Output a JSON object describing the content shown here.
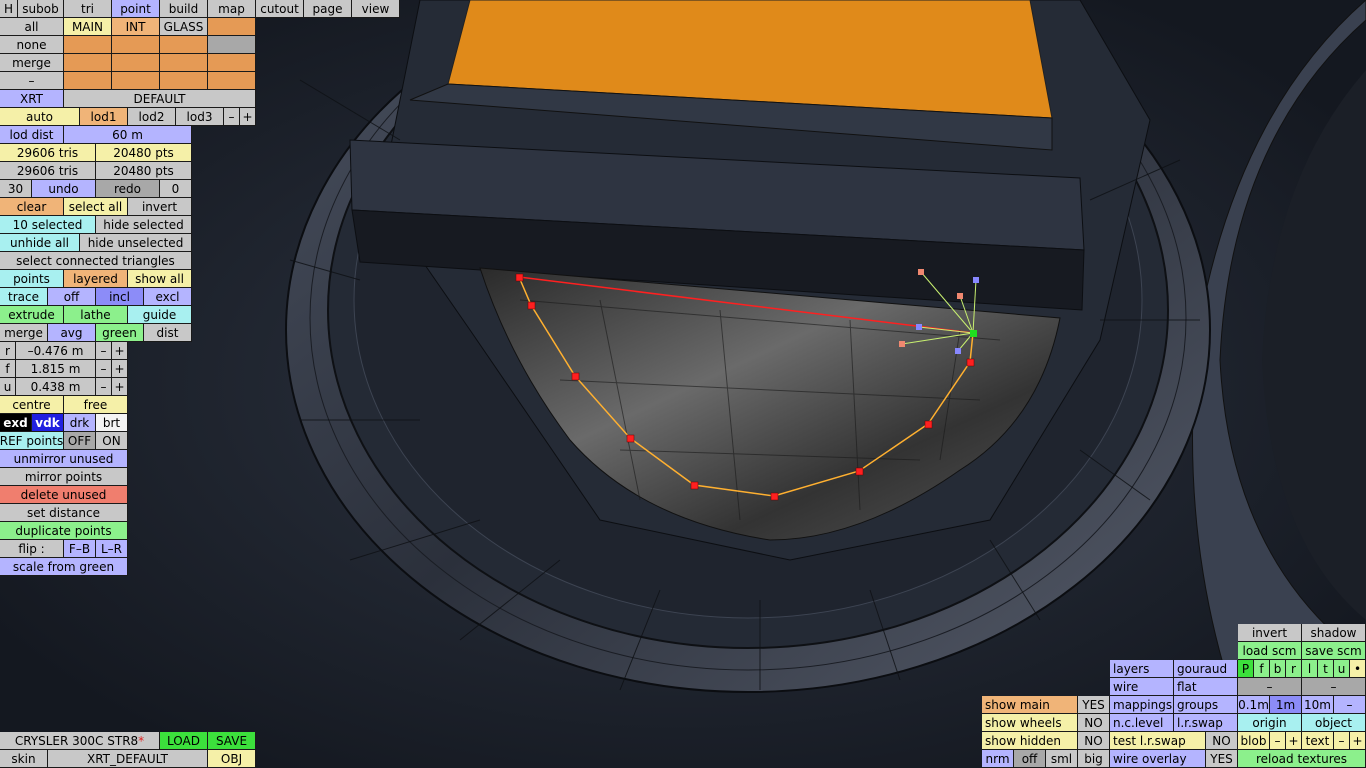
{
  "tabs": {
    "h": "H",
    "subob": "subob",
    "tri": "tri",
    "point": "point",
    "build": "build",
    "map": "map",
    "cutout": "cutout",
    "page": "page",
    "view": "view"
  },
  "mat": {
    "all": "all",
    "main": "MAIN",
    "int": "INT",
    "glass": "GLASS",
    "none": "none",
    "merge": "merge",
    "dash": "–"
  },
  "xrt": "XRT",
  "default": "DEFAULT",
  "lod": {
    "auto": "auto",
    "lod1": "lod1",
    "lod2": "lod2",
    "lod3": "lod3",
    "minus": "–",
    "plus": "+",
    "dist_label": "lod dist",
    "dist_value": "60 m"
  },
  "stats": {
    "tris1": "29606 tris",
    "pts1": "20480 pts",
    "tris2": "29606 tris",
    "pts2": "20480 pts"
  },
  "undo": {
    "count": "30",
    "undo": "undo",
    "redo": "redo",
    "redo_count": "0"
  },
  "sel": {
    "clear": "clear",
    "select_all": "select all",
    "invert": "invert",
    "selected": "10 selected",
    "hide_selected": "hide selected",
    "unhide_all": "unhide all",
    "hide_unselected": "hide unselected",
    "connected": "select connected triangles"
  },
  "modes": {
    "points": "points",
    "layered": "layered",
    "show_all": "show all",
    "trace": "trace",
    "off": "off",
    "incl": "incl",
    "excl": "excl",
    "extrude": "extrude",
    "lathe": "lathe",
    "guide": "guide",
    "merge": "merge",
    "avg": "avg",
    "green": "green",
    "dist": "dist"
  },
  "coords": [
    {
      "axis": "r",
      "value": "–0.476 m"
    },
    {
      "axis": "f",
      "value": "1.815 m"
    },
    {
      "axis": "u",
      "value": "0.438 m"
    }
  ],
  "pivot": {
    "centre": "centre",
    "free": "free"
  },
  "shade": {
    "exd": "exd",
    "vdk": "vdk",
    "drk": "drk",
    "brt": "brt"
  },
  "ref": {
    "label": "REF points",
    "off": "OFF",
    "on": "ON"
  },
  "ops": {
    "unmirror": "unmirror unused",
    "mirror": "mirror points",
    "delete": "delete unused",
    "set_distance": "set distance",
    "duplicate": "duplicate points",
    "flip": "flip :",
    "fb": "F–B",
    "lr": "L–R",
    "scale": "scale from green"
  },
  "file": {
    "car": "CRYSLER 300C STR8",
    "star": "*",
    "load": "LOAD",
    "save": "SAVE",
    "skin": "skin",
    "skin_name": "XRT_DEFAULT",
    "obj": "OBJ"
  },
  "show": {
    "main": "show main",
    "main_v": "YES",
    "wheels": "show wheels",
    "wheels_v": "NO",
    "hidden": "show hidden",
    "hidden_v": "NO",
    "nrm": "nrm",
    "off": "off",
    "sml": "sml",
    "big": "big"
  },
  "render": {
    "layers": "layers",
    "gouraud": "gouraud",
    "wire": "wire",
    "flat": "flat",
    "mappings": "mappings",
    "groups": "groups",
    "nclevel": "n.c.level",
    "lrswap": "l.r.swap",
    "test_lrswap": "test l.r.swap",
    "test_v": "NO",
    "overlay": "wire overlay",
    "overlay_v": "YES"
  },
  "right": {
    "invert": "invert",
    "shadow": "shadow",
    "load_scm": "load scm",
    "save_scm": "save scm",
    "flags": [
      "P",
      "f",
      "b",
      "r",
      "l",
      "t",
      "u",
      "•"
    ],
    "dash": "–",
    "g01": "0.1m",
    "g1": "1m",
    "g10": "10m",
    "origin": "origin",
    "object": "object",
    "blob": "blob",
    "text": "text",
    "plus": "+",
    "minus": "–",
    "reload": "reload textures"
  }
}
